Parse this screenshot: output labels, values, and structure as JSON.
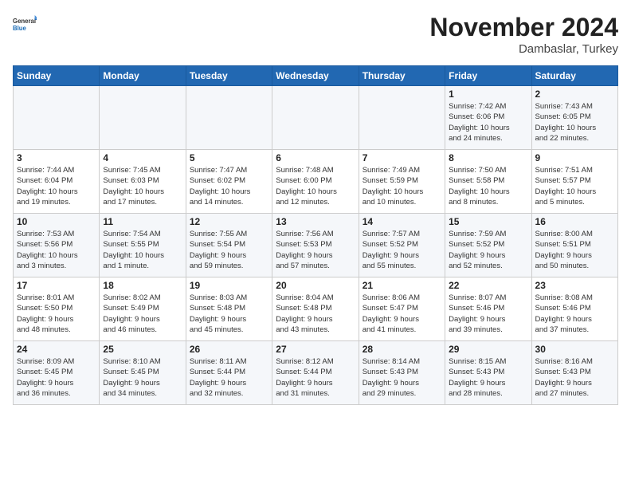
{
  "logo": {
    "general": "General",
    "blue": "Blue"
  },
  "title": "November 2024",
  "location": "Dambaslar, Turkey",
  "days_header": [
    "Sunday",
    "Monday",
    "Tuesday",
    "Wednesday",
    "Thursday",
    "Friday",
    "Saturday"
  ],
  "weeks": [
    [
      {
        "day": "",
        "info": ""
      },
      {
        "day": "",
        "info": ""
      },
      {
        "day": "",
        "info": ""
      },
      {
        "day": "",
        "info": ""
      },
      {
        "day": "",
        "info": ""
      },
      {
        "day": "1",
        "info": "Sunrise: 7:42 AM\nSunset: 6:06 PM\nDaylight: 10 hours\nand 24 minutes."
      },
      {
        "day": "2",
        "info": "Sunrise: 7:43 AM\nSunset: 6:05 PM\nDaylight: 10 hours\nand 22 minutes."
      }
    ],
    [
      {
        "day": "3",
        "info": "Sunrise: 7:44 AM\nSunset: 6:04 PM\nDaylight: 10 hours\nand 19 minutes."
      },
      {
        "day": "4",
        "info": "Sunrise: 7:45 AM\nSunset: 6:03 PM\nDaylight: 10 hours\nand 17 minutes."
      },
      {
        "day": "5",
        "info": "Sunrise: 7:47 AM\nSunset: 6:02 PM\nDaylight: 10 hours\nand 14 minutes."
      },
      {
        "day": "6",
        "info": "Sunrise: 7:48 AM\nSunset: 6:00 PM\nDaylight: 10 hours\nand 12 minutes."
      },
      {
        "day": "7",
        "info": "Sunrise: 7:49 AM\nSunset: 5:59 PM\nDaylight: 10 hours\nand 10 minutes."
      },
      {
        "day": "8",
        "info": "Sunrise: 7:50 AM\nSunset: 5:58 PM\nDaylight: 10 hours\nand 8 minutes."
      },
      {
        "day": "9",
        "info": "Sunrise: 7:51 AM\nSunset: 5:57 PM\nDaylight: 10 hours\nand 5 minutes."
      }
    ],
    [
      {
        "day": "10",
        "info": "Sunrise: 7:53 AM\nSunset: 5:56 PM\nDaylight: 10 hours\nand 3 minutes."
      },
      {
        "day": "11",
        "info": "Sunrise: 7:54 AM\nSunset: 5:55 PM\nDaylight: 10 hours\nand 1 minute."
      },
      {
        "day": "12",
        "info": "Sunrise: 7:55 AM\nSunset: 5:54 PM\nDaylight: 9 hours\nand 59 minutes."
      },
      {
        "day": "13",
        "info": "Sunrise: 7:56 AM\nSunset: 5:53 PM\nDaylight: 9 hours\nand 57 minutes."
      },
      {
        "day": "14",
        "info": "Sunrise: 7:57 AM\nSunset: 5:52 PM\nDaylight: 9 hours\nand 55 minutes."
      },
      {
        "day": "15",
        "info": "Sunrise: 7:59 AM\nSunset: 5:52 PM\nDaylight: 9 hours\nand 52 minutes."
      },
      {
        "day": "16",
        "info": "Sunrise: 8:00 AM\nSunset: 5:51 PM\nDaylight: 9 hours\nand 50 minutes."
      }
    ],
    [
      {
        "day": "17",
        "info": "Sunrise: 8:01 AM\nSunset: 5:50 PM\nDaylight: 9 hours\nand 48 minutes."
      },
      {
        "day": "18",
        "info": "Sunrise: 8:02 AM\nSunset: 5:49 PM\nDaylight: 9 hours\nand 46 minutes."
      },
      {
        "day": "19",
        "info": "Sunrise: 8:03 AM\nSunset: 5:48 PM\nDaylight: 9 hours\nand 45 minutes."
      },
      {
        "day": "20",
        "info": "Sunrise: 8:04 AM\nSunset: 5:48 PM\nDaylight: 9 hours\nand 43 minutes."
      },
      {
        "day": "21",
        "info": "Sunrise: 8:06 AM\nSunset: 5:47 PM\nDaylight: 9 hours\nand 41 minutes."
      },
      {
        "day": "22",
        "info": "Sunrise: 8:07 AM\nSunset: 5:46 PM\nDaylight: 9 hours\nand 39 minutes."
      },
      {
        "day": "23",
        "info": "Sunrise: 8:08 AM\nSunset: 5:46 PM\nDaylight: 9 hours\nand 37 minutes."
      }
    ],
    [
      {
        "day": "24",
        "info": "Sunrise: 8:09 AM\nSunset: 5:45 PM\nDaylight: 9 hours\nand 36 minutes."
      },
      {
        "day": "25",
        "info": "Sunrise: 8:10 AM\nSunset: 5:45 PM\nDaylight: 9 hours\nand 34 minutes."
      },
      {
        "day": "26",
        "info": "Sunrise: 8:11 AM\nSunset: 5:44 PM\nDaylight: 9 hours\nand 32 minutes."
      },
      {
        "day": "27",
        "info": "Sunrise: 8:12 AM\nSunset: 5:44 PM\nDaylight: 9 hours\nand 31 minutes."
      },
      {
        "day": "28",
        "info": "Sunrise: 8:14 AM\nSunset: 5:43 PM\nDaylight: 9 hours\nand 29 minutes."
      },
      {
        "day": "29",
        "info": "Sunrise: 8:15 AM\nSunset: 5:43 PM\nDaylight: 9 hours\nand 28 minutes."
      },
      {
        "day": "30",
        "info": "Sunrise: 8:16 AM\nSunset: 5:43 PM\nDaylight: 9 hours\nand 27 minutes."
      }
    ]
  ]
}
